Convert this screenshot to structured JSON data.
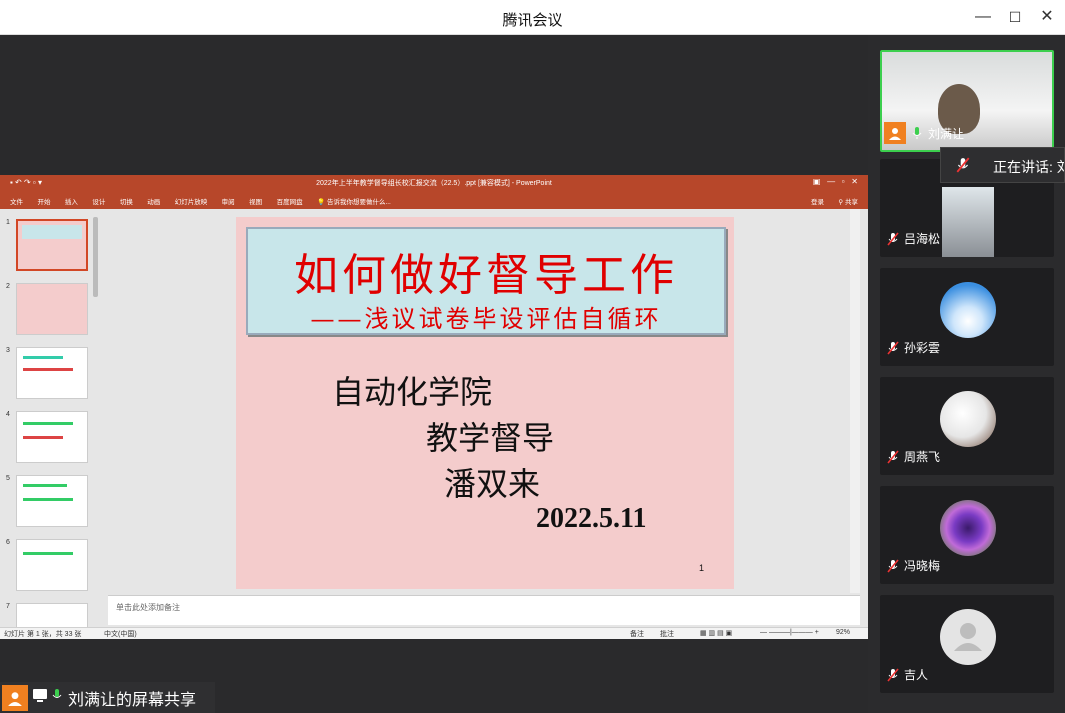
{
  "window": {
    "title": "腾讯会议",
    "min": "—",
    "max": "☐",
    "close": "✕"
  },
  "ppt": {
    "title": "2022年上半年教学督导组长校汇报交流（22.5）.ppt [兼容模式] - PowerPoint",
    "tabs": [
      "文件",
      "开始",
      "插入",
      "设计",
      "切换",
      "动画",
      "幻灯片放映",
      "审阅",
      "视图",
      "百度网盘"
    ],
    "tell_me": "告诉我你想要做什么...",
    "login": "登录",
    "share_label": "共享",
    "thumb_numbers": [
      "1",
      "2",
      "3",
      "4",
      "5",
      "6",
      "7"
    ],
    "slide": {
      "title": "如何做好督导工作",
      "subtitle": "——浅议试卷毕设评估自循环",
      "line1": "自动化学院",
      "line2": "教学督导",
      "line3": "潘双来",
      "date": "2022.5.11",
      "page": "1"
    },
    "notes_placeholder": "单击此处添加备注",
    "status": {
      "slide_info": "幻灯片 第 1 张，共 33 张",
      "lang": "中文(中国)",
      "notes": "备注",
      "comments": "批注",
      "zoom": "92%"
    }
  },
  "participants": [
    {
      "name": "刘满让",
      "active": true
    },
    {
      "name": "吕海松"
    },
    {
      "name": "孙彩雲"
    },
    {
      "name": "周燕飞"
    },
    {
      "name": "冯晓梅"
    },
    {
      "name": "吉人"
    }
  ],
  "speaking_tooltip": "正在讲话: 刘",
  "share_label": "刘满让的屏幕共享",
  "colors": {
    "ppt_red": "#b7472a",
    "active_green": "#3ccf4e",
    "slide_bg": "#f4cccc",
    "title_red": "#e00000"
  }
}
